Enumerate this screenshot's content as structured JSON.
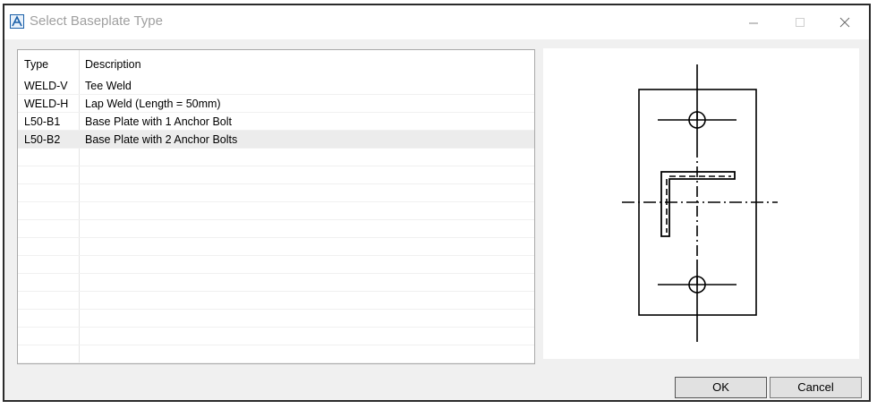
{
  "window": {
    "title": "Select Baseplate Type"
  },
  "controls": {
    "minimize": "minimize",
    "maximize": "maximize",
    "close": "close"
  },
  "list": {
    "headers": {
      "type": "Type",
      "description": "Description"
    },
    "rows": [
      {
        "type": "WELD-V",
        "description": "Tee Weld",
        "selected": false
      },
      {
        "type": "WELD-H",
        "description": "Lap Weld (Length = 50mm)",
        "selected": false
      },
      {
        "type": "L50-B1",
        "description": "Base Plate with 1 Anchor Bolt",
        "selected": false
      },
      {
        "type": "L50-B2",
        "description": "Base Plate with 2 Anchor Bolts",
        "selected": true
      }
    ]
  },
  "buttons": {
    "ok": "OK",
    "cancel": "Cancel"
  }
}
